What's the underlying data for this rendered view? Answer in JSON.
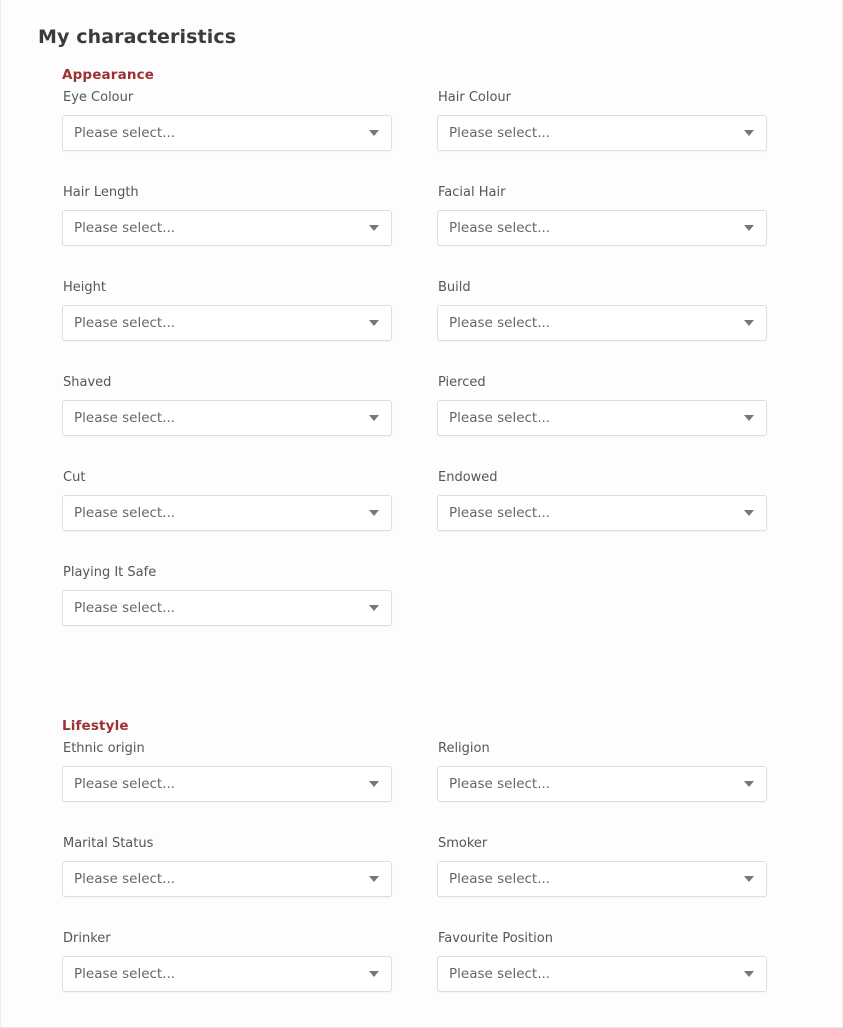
{
  "page": {
    "title": "My characteristics",
    "accent_color": "#9d3131",
    "background_color": "#fdfdfd",
    "label_color": "#565656",
    "title_color": "#3b3b3b"
  },
  "select": {
    "placeholder": "Please select...",
    "arrow_icon": "chevron-down-icon"
  },
  "sections": [
    {
      "id": "appearance",
      "title": "Appearance",
      "rows": [
        {
          "left": {
            "id": "eye-colour",
            "label": "Eye Colour",
            "value": "Please select..."
          },
          "right": {
            "id": "hair-colour",
            "label": "Hair Colour",
            "value": "Please select..."
          }
        },
        {
          "left": {
            "id": "hair-length",
            "label": "Hair Length",
            "value": "Please select..."
          },
          "right": {
            "id": "facial-hair",
            "label": "Facial Hair",
            "value": "Please select..."
          }
        },
        {
          "left": {
            "id": "height",
            "label": "Height",
            "value": "Please select..."
          },
          "right": {
            "id": "build",
            "label": "Build",
            "value": "Please select..."
          }
        },
        {
          "left": {
            "id": "shaved",
            "label": "Shaved",
            "value": "Please select..."
          },
          "right": {
            "id": "pierced",
            "label": "Pierced",
            "value": "Please select..."
          }
        },
        {
          "left": {
            "id": "cut",
            "label": "Cut",
            "value": "Please select..."
          },
          "right": {
            "id": "endowed",
            "label": "Endowed",
            "value": "Please select..."
          }
        },
        {
          "left": {
            "id": "playing-it-safe",
            "label": "Playing It Safe",
            "value": "Please select..."
          },
          "right": null
        }
      ]
    },
    {
      "id": "lifestyle",
      "title": "Lifestyle",
      "rows": [
        {
          "left": {
            "id": "ethnic-origin",
            "label": "Ethnic origin",
            "value": "Please select..."
          },
          "right": {
            "id": "religion",
            "label": "Religion",
            "value": "Please select..."
          }
        },
        {
          "left": {
            "id": "marital-status",
            "label": "Marital Status",
            "value": "Please select..."
          },
          "right": {
            "id": "smoker",
            "label": "Smoker",
            "value": "Please select..."
          }
        },
        {
          "left": {
            "id": "drinker",
            "label": "Drinker",
            "value": "Please select..."
          },
          "right": {
            "id": "favourite-position",
            "label": "Favourite Position",
            "value": "Please select..."
          }
        }
      ]
    }
  ]
}
